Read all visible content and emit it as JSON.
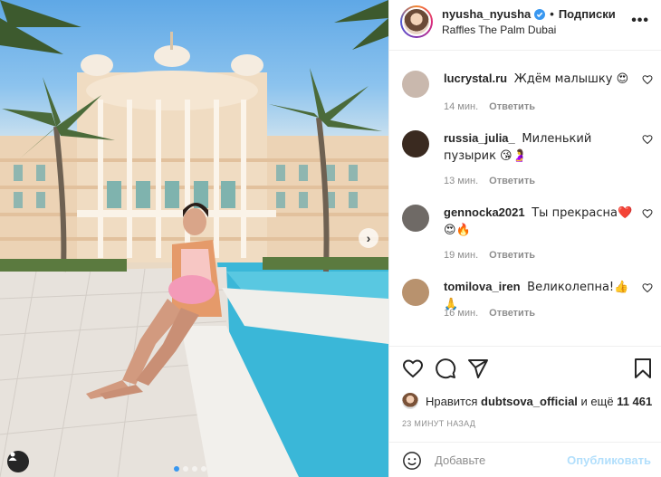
{
  "post": {
    "username": "nyusha_nyusha",
    "follow_label": "Подписки",
    "location": "Raffles The Palm Dubai",
    "more_label": "•••",
    "carousel_dots": 4,
    "active_dot": 0
  },
  "comments": [
    {
      "user": "lucrystal.ru",
      "text": "Ждём малышку 😍",
      "time": "14 мин.",
      "reply": "Ответить",
      "avatar_color": "#c9b8ad"
    },
    {
      "user": "russia_julia_",
      "text": "Миленький пузырик 😘🤰",
      "time": "13 мин.",
      "reply": "Ответить",
      "avatar_color": "#3a2a20"
    },
    {
      "user": "gennocka2021",
      "text": "Ты прекрасна❤️😍🔥",
      "time": "19 мин.",
      "reply": "Ответить",
      "avatar_color": "#6f6a66"
    },
    {
      "user": "tomilova_iren",
      "text": "Великолепна!👍🙏",
      "time": "16 мин.",
      "reply": "Ответить",
      "avatar_color": "#b8926e"
    }
  ],
  "likes": {
    "prefix": "Нравится",
    "user": "dubtsova_official",
    "middle": "и ещё",
    "count": "11 461"
  },
  "time_ago": "23 МИНУТ НАЗАД",
  "add_comment": {
    "placeholder": "Добавьте",
    "publish_label": "Опубликовать"
  },
  "icons": {
    "like": "heart-icon",
    "comment": "comment-icon",
    "share": "paper-plane-icon",
    "save": "bookmark-icon",
    "emoji": "smiley-icon",
    "tag": "user-tag-icon",
    "verified": "verified-badge-icon"
  },
  "colors": {
    "accent": "#3897f0",
    "publish_disabled": "#b2dffc",
    "muted": "#8e8e8e",
    "text": "#262626"
  }
}
